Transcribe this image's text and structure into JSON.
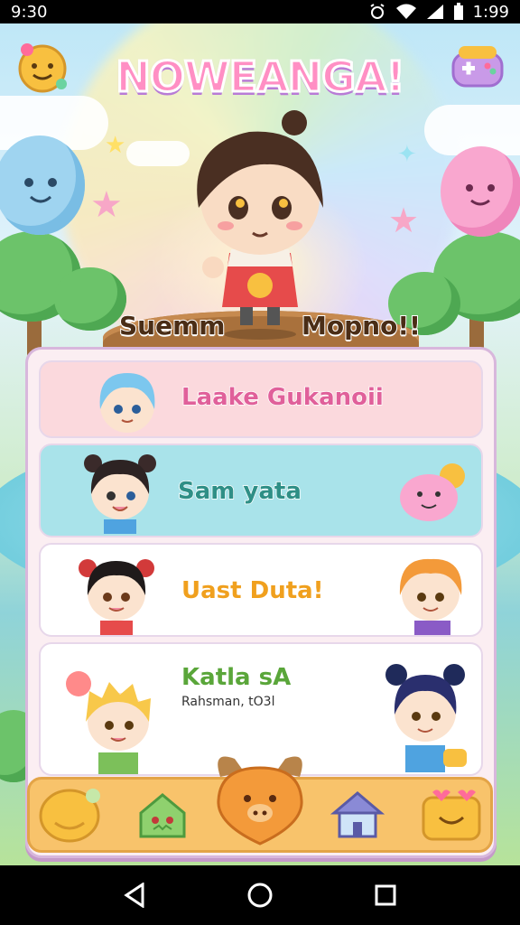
{
  "status": {
    "time": "9:30",
    "clock": "1:99"
  },
  "header": {
    "title": "NOWEANGA!",
    "left_button_icon": "smiley-badge-icon",
    "right_button_icon": "controller-icon"
  },
  "stage": {
    "left_label": "Suemm",
    "right_label": "Mopno!!"
  },
  "list": [
    {
      "label": "Laake Gukanoii",
      "color": "#e0609a",
      "bg": "#fbd9dd"
    },
    {
      "label": "Sam yata",
      "color": "#2e8f86",
      "bg": "#a9e3ea"
    },
    {
      "label": "Uast Duta!",
      "color": "#f0a01e",
      "bg": "#ffffff"
    },
    {
      "label": "Katla sA",
      "sub": "Rahsman, tO3l",
      "color": "#5aa63a",
      "bg": "#ffffff"
    }
  ],
  "bottom_nav": [
    "chat-icon",
    "home-monster-icon",
    "pet-center-icon",
    "house-icon",
    "happy-box-icon"
  ],
  "colors": {
    "panel": "#fbeef2",
    "accent": "#f8c36b"
  }
}
